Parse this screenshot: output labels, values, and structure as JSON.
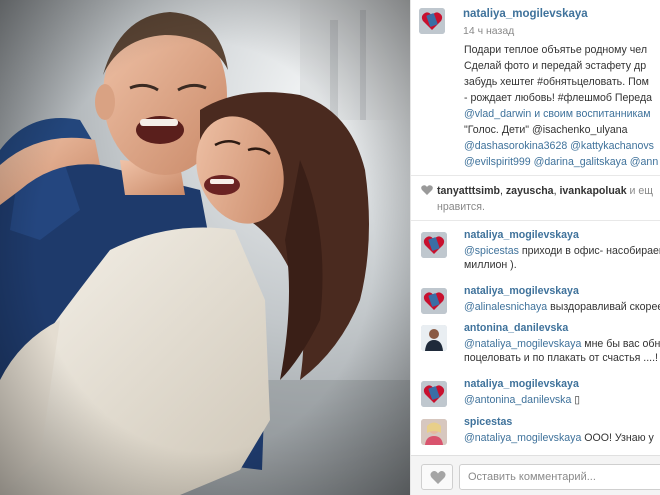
{
  "photo": {
    "alt_icon": "photo-couple"
  },
  "post": {
    "username": "nataliya_mogilevskaya",
    "time": "14 ч назад",
    "caption_lines": [
      "Подари теплое объятье родному чел",
      "Сделай фото и передай эстафету др",
      "забудь хештег #обнятьцеловать. Пом",
      "- рождает любовь! #флешмоб Переда",
      "@vlad_darwin и своим воспитанникам",
      "\"Голос. Дети\" @isachenko_ulyana",
      "@dashasorokina3628 @kattykachanovs",
      "@evilspirit999 @darina_galitskaya @ann"
    ]
  },
  "likes": {
    "names": [
      "tanyatttsimb",
      "zayuscha",
      "ivankapoluak"
    ],
    "and_more": "и ещ",
    "suffix": "нравится."
  },
  "comments": [
    {
      "user": "nataliya_mogilevskaya",
      "mention": "@spicestas",
      "text": " приходи в офис- насобираем",
      "line2": "миллион )."
    },
    {
      "user": "nataliya_mogilevskaya",
      "mention": "@alinalesnichaya",
      "text": " выздоравливай скорее",
      "line2": ""
    },
    {
      "user": "antonina_danilevska",
      "mention": "@nataliya_mogilevskaya",
      "text": " мне бы вас обня",
      "line2": "поцеловать и по плакать от счастья ....!"
    },
    {
      "user": "nataliya_mogilevskaya",
      "mention": "@antonina_danilevska",
      "text": " ▯",
      "line2": ""
    },
    {
      "user": "spicestas",
      "mention": "@nataliya_mogilevskaya",
      "text": " ООО! Узнаю у",
      "line2": ""
    }
  ],
  "footer": {
    "like_icon": "heart-icon",
    "comment_placeholder": "Оставить комментарий..."
  },
  "colors": {
    "link": "#3f729b",
    "muted": "#888888"
  }
}
